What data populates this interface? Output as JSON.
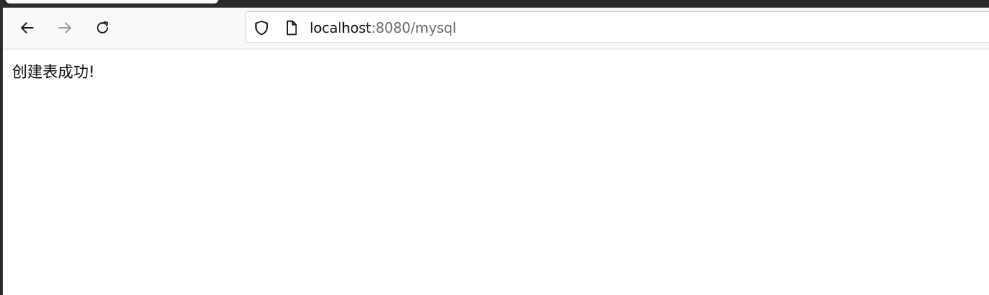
{
  "toolbar": {
    "back_icon": "arrow-left-icon",
    "forward_icon": "arrow-right-icon",
    "reload_icon": "reload-icon"
  },
  "urlbar": {
    "security_icon": "shield-icon",
    "page_icon": "page-icon",
    "host": "localhost",
    "rest": ":8080/mysql"
  },
  "page": {
    "message": "创建表成功!"
  },
  "colors": {
    "tabstrip": "#2b2b2b",
    "toolbar": "#f9f9fb",
    "url_host": "#15141a",
    "url_rest": "#6d6d72"
  }
}
